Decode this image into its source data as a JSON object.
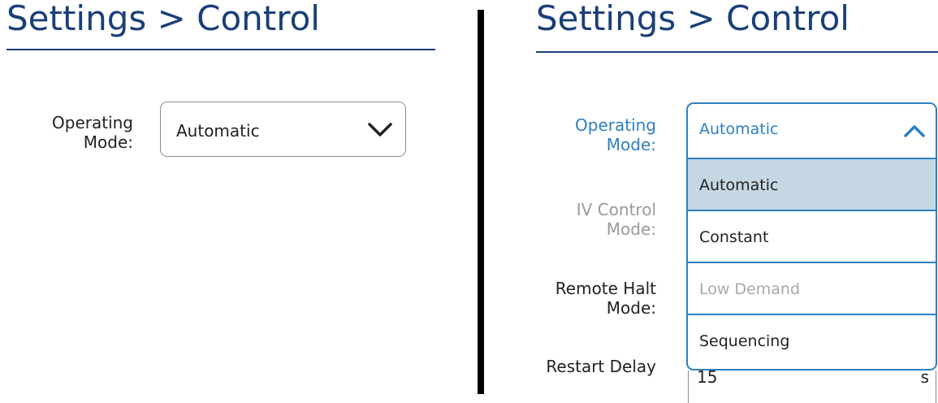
{
  "left_panel": {
    "title": "Settings > Control",
    "operating_mode": {
      "label_line1": "Operating",
      "label_line2": "Mode:",
      "value": "Automatic",
      "icon": "chevron-down-icon"
    }
  },
  "right_panel": {
    "title": "Settings > Control",
    "operating_mode": {
      "label_line1": "Operating",
      "label_line2": "Mode:",
      "value": "Automatic",
      "icon": "chevron-up-icon",
      "options": [
        {
          "label": "Automatic",
          "state": "selected"
        },
        {
          "label": "Constant",
          "state": "normal"
        },
        {
          "label": "Low Demand",
          "state": "disabled"
        },
        {
          "label": "Sequencing",
          "state": "normal"
        }
      ]
    },
    "iv_control_mode": {
      "label_line1": "IV Control",
      "label_line2": "Mode:"
    },
    "remote_halt_mode": {
      "label_line1": "Remote Halt",
      "label_line2": "Mode:"
    },
    "restart_delay": {
      "label": "Restart Delay",
      "value": "15",
      "unit": "s"
    }
  },
  "colors": {
    "title": "#1a3f78",
    "accent": "#2f7fc0",
    "selected_option_bg": "#c6d7e4",
    "disabled_text": "#9a9a9a"
  }
}
